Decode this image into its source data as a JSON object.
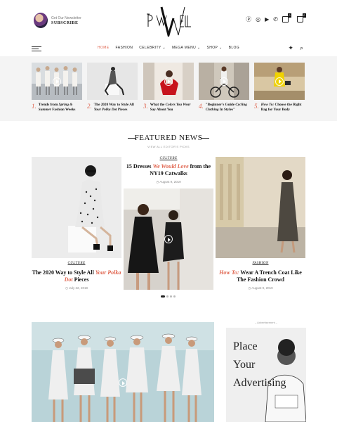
{
  "header": {
    "newsletter_small": "Get Our Newsletter",
    "subscribe": "SUBSCRIBE",
    "logo_text": "PW"
  },
  "social_icons": [
    "pinterest-icon",
    "instagram-icon",
    "youtube-icon",
    "whatsapp-icon"
  ],
  "cart": {
    "badge": "0"
  },
  "bag": {
    "badge": "0"
  },
  "nav": {
    "items": [
      {
        "label": "Home",
        "active": true
      },
      {
        "label": "Fashion"
      },
      {
        "label": "Celebrity ⌄"
      },
      {
        "label": "Mega Menu ⌄"
      },
      {
        "label": "Shop ⌄"
      },
      {
        "label": "Blog"
      }
    ]
  },
  "trending": [
    {
      "num": "1.",
      "title_a": "Trends from ",
      "title_em": "Spring & Summer",
      "title_b": " Fashion Weeks"
    },
    {
      "num": "2.",
      "title_a": "The 2020 Way to Style All ",
      "title_em": "Your Polka Dot",
      "title_b": " Pieces"
    },
    {
      "num": "3.",
      "title_a": "What the ",
      "title_em": "Colors You Wear",
      "title_b": " Say About You"
    },
    {
      "num": "4.",
      "title_a": "\"Beginner's Guide ",
      "title_em": "Cycling Clothing",
      "title_b": " In Styles\""
    },
    {
      "num": "5.",
      "title_a": "",
      "title_em": "How To:",
      "title_b": " Choose the Right Bag for Your Body"
    }
  ],
  "featured": {
    "title": "FEATURED NEWS",
    "subtitle": "VIEW ALL EDITOR'S PICKS",
    "left": {
      "category": "CULTURE",
      "title_a": "The 2020 Way to Style All ",
      "title_em": "Your Polka Dot",
      "title_b": " Pieces",
      "date": "◷ July 22, 2019"
    },
    "center": {
      "category": "CULTURE",
      "title_a": "15 Dresses ",
      "title_em": "We Would Love",
      "title_b": " from the NY19 Catwalks",
      "date": "◷ August 9, 2019"
    },
    "right": {
      "category": "FASHION",
      "title_em": "How To:",
      "title_b": " Wear A Trench Coat Like The Fashion Crowd",
      "date": "◷ August 9, 2019"
    }
  },
  "advert": {
    "label": "– Advertisement –",
    "line1": "Place",
    "line2": "Your",
    "line3": "Advertising"
  }
}
